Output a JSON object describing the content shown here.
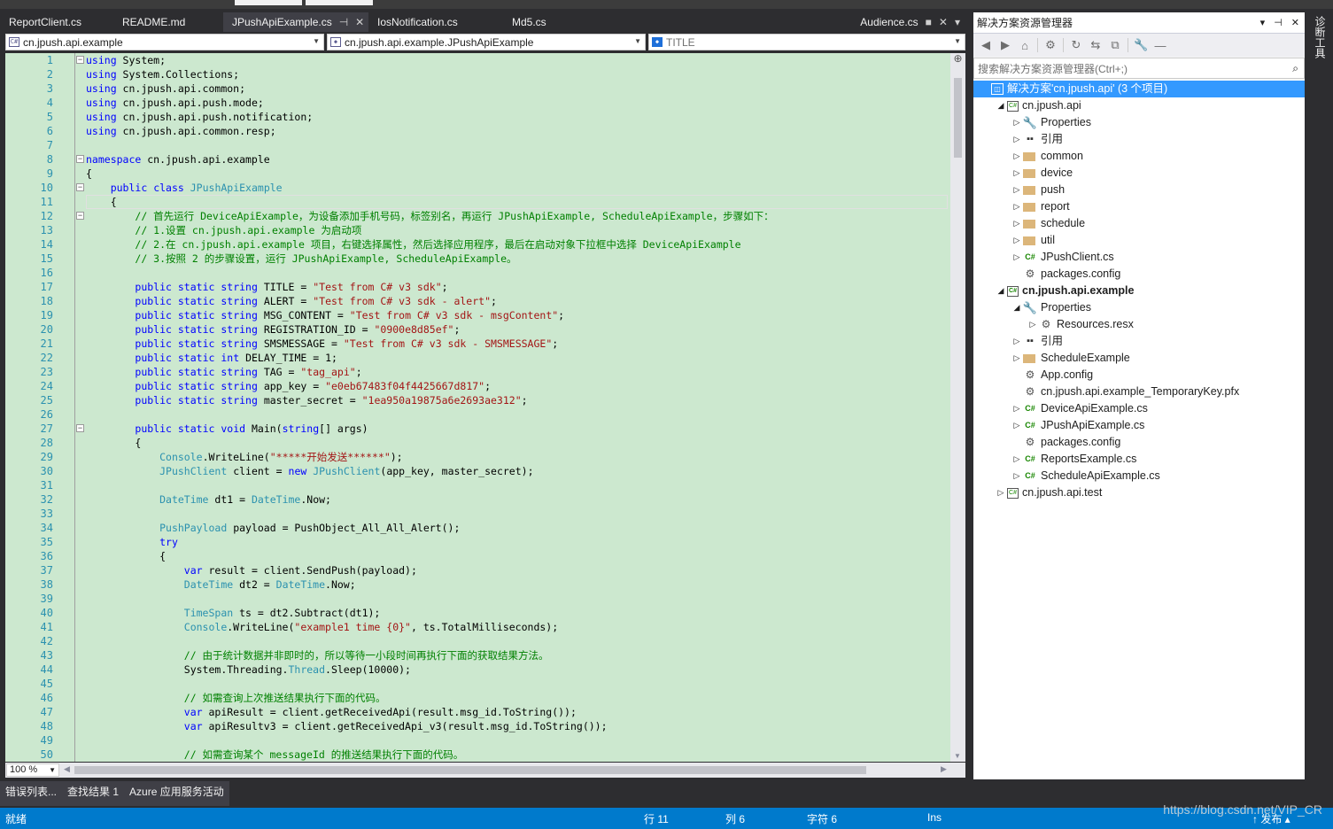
{
  "tabs": [
    {
      "label": "ReportClient.cs",
      "active": false
    },
    {
      "label": "README.md",
      "active": false
    },
    {
      "label": "JPushApiExample.cs",
      "active": true,
      "pin": "⊣",
      "close": "✕"
    },
    {
      "label": "IosNotification.cs",
      "active": false
    },
    {
      "label": "Md5.cs",
      "active": false
    }
  ],
  "right_tab": {
    "label": "Audience.cs",
    "pin": "■",
    "close": "✕",
    "menu": "▾"
  },
  "navbar": {
    "project": "cn.jpush.api.example",
    "type": "cn.jpush.api.example.JPushApiExample",
    "member": "TITLE",
    "project_icon": "C#"
  },
  "editor": {
    "zoom": "100 %",
    "line_numbers": [
      "1",
      "2",
      "3",
      "4",
      "5",
      "6",
      "7",
      "8",
      "9",
      "10",
      "11",
      "12",
      "13",
      "14",
      "15",
      "16",
      "17",
      "18",
      "19",
      "20",
      "21",
      "22",
      "23",
      "24",
      "25",
      "26",
      "27",
      "28",
      "29",
      "30",
      "31",
      "32",
      "33",
      "34",
      "35",
      "36",
      "37",
      "38",
      "39",
      "40",
      "41",
      "42",
      "43",
      "44",
      "45",
      "46",
      "47",
      "48",
      "49",
      "50"
    ],
    "code_lines": [
      "using System;",
      "using System.Collections;",
      "using cn.jpush.api.common;",
      "using cn.jpush.api.push.mode;",
      "using cn.jpush.api.push.notification;",
      "using cn.jpush.api.common.resp;",
      "",
      "namespace cn.jpush.api.example",
      "{",
      "    public class JPushApiExample",
      "    {",
      "        // 首先运行 DeviceApiExample，为设备添加手机号码，标签别名，再运行 JPushApiExample, ScheduleApiExample，步骤如下：",
      "        // 1.设置 cn.jpush.api.example 为启动项",
      "        // 2.在 cn.jpush.api.example 项目，右键选择属性，然后选择应用程序，最后在启动对象下拉框中选择 DeviceApiExample",
      "        // 3.按照 2 的步骤设置，运行 JPushApiExample, ScheduleApiExample。",
      "",
      "        public static string TITLE = \"Test from C# v3 sdk\";",
      "        public static string ALERT = \"Test from C# v3 sdk - alert\";",
      "        public static string MSG_CONTENT = \"Test from C# v3 sdk - msgContent\";",
      "        public static string REGISTRATION_ID = \"0900e8d85ef\";",
      "        public static string SMSMESSAGE = \"Test from C# v3 sdk - SMSMESSAGE\";",
      "        public static int DELAY_TIME = 1;",
      "        public static string TAG = \"tag_api\";",
      "        public static string app_key = \"e0eb67483f04f4425667d817\";",
      "        public static string master_secret = \"1ea950a19875a6e2693ae312\";",
      "",
      "        public static void Main(string[] args)",
      "        {",
      "            Console.WriteLine(\"*****开始发送******\");",
      "            JPushClient client = new JPushClient(app_key, master_secret);",
      "",
      "            DateTime dt1 = DateTime.Now;",
      "",
      "            PushPayload payload = PushObject_All_All_Alert();",
      "            try",
      "            {",
      "                var result = client.SendPush(payload);",
      "                DateTime dt2 = DateTime.Now;",
      "",
      "                TimeSpan ts = dt2.Subtract(dt1);",
      "                Console.WriteLine(\"example1 time {0}\", ts.TotalMilliseconds);",
      "",
      "                // 由于统计数据并非即时的，所以等待一小段时间再执行下面的获取结果方法。",
      "                System.Threading.Thread.Sleep(10000);",
      "",
      "                // 如需查询上次推送结果执行下面的代码。",
      "                var apiResult = client.getReceivedApi(result.msg_id.ToString());",
      "                var apiResultv3 = client.getReceivedApi_v3(result.msg_id.ToString());",
      "",
      "                // 如需查询某个 messageId 的推送结果执行下面的代码。"
    ]
  },
  "solution_explorer": {
    "title": "解决方案资源管理器",
    "title_buttons": [
      "▾",
      "⊣",
      "✕"
    ],
    "search_placeholder": "搜索解决方案资源管理器(Ctrl+;)",
    "search_icon": "⌕",
    "toolbar_icons": [
      "◀",
      "▶",
      "⌂",
      "⚙",
      "↻",
      "⇆",
      "⧉",
      "🔧",
      "—"
    ],
    "tree": [
      {
        "label": "解决方案'cn.jpush.api' (3 个项目)",
        "depth": 0,
        "icon": "sln",
        "expander": "",
        "selected": true,
        "bold": false
      },
      {
        "label": "cn.jpush.api",
        "depth": 1,
        "icon": "proj",
        "expander": "◢",
        "selected": false,
        "bold": false
      },
      {
        "label": "Properties",
        "depth": 2,
        "icon": "wrench",
        "expander": "▷",
        "selected": false,
        "bold": false
      },
      {
        "label": "引用",
        "depth": 2,
        "icon": "ref",
        "expander": "▷",
        "selected": false,
        "bold": false
      },
      {
        "label": "common",
        "depth": 2,
        "icon": "folder",
        "expander": "▷",
        "selected": false,
        "bold": false
      },
      {
        "label": "device",
        "depth": 2,
        "icon": "folder",
        "expander": "▷",
        "selected": false,
        "bold": false
      },
      {
        "label": "push",
        "depth": 2,
        "icon": "folder",
        "expander": "▷",
        "selected": false,
        "bold": false
      },
      {
        "label": "report",
        "depth": 2,
        "icon": "folder",
        "expander": "▷",
        "selected": false,
        "bold": false
      },
      {
        "label": "schedule",
        "depth": 2,
        "icon": "folder",
        "expander": "▷",
        "selected": false,
        "bold": false
      },
      {
        "label": "util",
        "depth": 2,
        "icon": "folder",
        "expander": "▷",
        "selected": false,
        "bold": false
      },
      {
        "label": "JPushClient.cs",
        "depth": 2,
        "icon": "cs",
        "expander": "▷",
        "selected": false,
        "bold": false
      },
      {
        "label": "packages.config",
        "depth": 2,
        "icon": "cfg",
        "expander": "",
        "selected": false,
        "bold": false
      },
      {
        "label": "cn.jpush.api.example",
        "depth": 1,
        "icon": "proj",
        "expander": "◢",
        "selected": false,
        "bold": true
      },
      {
        "label": "Properties",
        "depth": 2,
        "icon": "wrench",
        "expander": "◢",
        "selected": false,
        "bold": false
      },
      {
        "label": "Resources.resx",
        "depth": 3,
        "icon": "cfg",
        "expander": "▷",
        "selected": false,
        "bold": false
      },
      {
        "label": "引用",
        "depth": 2,
        "icon": "ref",
        "expander": "▷",
        "selected": false,
        "bold": false
      },
      {
        "label": "ScheduleExample",
        "depth": 2,
        "icon": "folder",
        "expander": "▷",
        "selected": false,
        "bold": false
      },
      {
        "label": "App.config",
        "depth": 2,
        "icon": "cfg",
        "expander": "",
        "selected": false,
        "bold": false
      },
      {
        "label": "cn.jpush.api.example_TemporaryKey.pfx",
        "depth": 2,
        "icon": "cfg",
        "expander": "",
        "selected": false,
        "bold": false
      },
      {
        "label": "DeviceApiExample.cs",
        "depth": 2,
        "icon": "cs",
        "expander": "▷",
        "selected": false,
        "bold": false
      },
      {
        "label": "JPushApiExample.cs",
        "depth": 2,
        "icon": "cs",
        "expander": "▷",
        "selected": false,
        "bold": false
      },
      {
        "label": "packages.config",
        "depth": 2,
        "icon": "cfg",
        "expander": "",
        "selected": false,
        "bold": false
      },
      {
        "label": "ReportsExample.cs",
        "depth": 2,
        "icon": "cs",
        "expander": "▷",
        "selected": false,
        "bold": false
      },
      {
        "label": "ScheduleApiExample.cs",
        "depth": 2,
        "icon": "cs",
        "expander": "▷",
        "selected": false,
        "bold": false
      },
      {
        "label": "cn.jpush.api.test",
        "depth": 1,
        "icon": "proj",
        "expander": "▷",
        "selected": false,
        "bold": false
      }
    ]
  },
  "side_strip": {
    "label": "诊断工具"
  },
  "bottom_tabs": [
    {
      "label": "错误列表...",
      "active": true
    },
    {
      "label": "查找结果 1",
      "active": true
    },
    {
      "label": "Azure 应用服务活动",
      "active": true
    }
  ],
  "status": {
    "ready": "就绪",
    "line": "行 11",
    "col": "列 6",
    "char": "字符 6",
    "mode": "Ins",
    "publish": "↑ 发布 ▴"
  },
  "watermark": "https://blog.csdn.net/VIP_CR"
}
